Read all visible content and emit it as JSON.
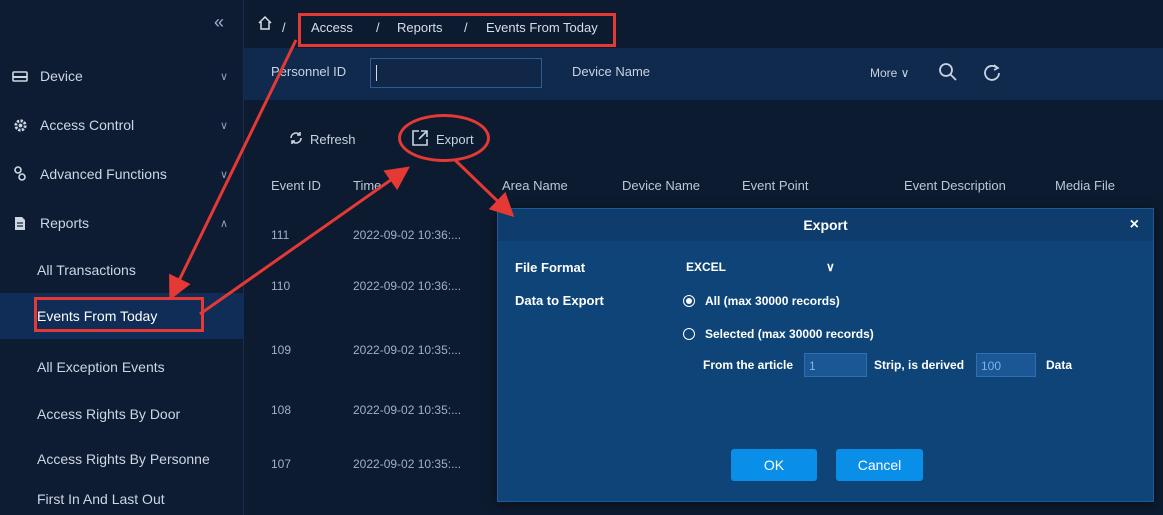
{
  "sidebar": {
    "collapse_glyph": "«",
    "sections": [
      {
        "label": "Device",
        "icon": "device-icon"
      },
      {
        "label": "Access Control",
        "icon": "gear-icon"
      },
      {
        "label": "Advanced Functions",
        "icon": "advanced-icon"
      },
      {
        "label": "Reports",
        "icon": "document-icon"
      }
    ],
    "report_items": [
      "All Transactions",
      "Events From Today",
      "All Exception Events",
      "Access Rights By Door",
      "Access Rights By Personne",
      "First In And Last Out"
    ],
    "active_item": "Events From Today"
  },
  "breadcrumb": {
    "home_icon": "home-icon",
    "separator": "/",
    "items": [
      "Access",
      "Reports",
      "Events From Today"
    ]
  },
  "filter": {
    "personnel_id_label": "Personnel ID",
    "personnel_id_value": "",
    "device_name_label": "Device Name",
    "more_label": "More"
  },
  "toolbar": {
    "refresh_label": "Refresh",
    "export_label": "Export"
  },
  "table": {
    "headers": [
      "Event ID",
      "Time",
      "Area Name",
      "Device Name",
      "Event Point",
      "Event Description",
      "Media File"
    ],
    "rows": [
      {
        "id": "111",
        "time": "2022-09-02 10:36:..."
      },
      {
        "id": "110",
        "time": "2022-09-02 10:36:..."
      },
      {
        "id": "109",
        "time": "2022-09-02 10:35:..."
      },
      {
        "id": "108",
        "time": "2022-09-02 10:35:..."
      },
      {
        "id": "107",
        "time": "2022-09-02 10:35:..."
      }
    ]
  },
  "dialog": {
    "title": "Export",
    "close_glyph": "×",
    "file_format_label": "File Format",
    "file_format_value": "EXCEL",
    "data_to_export_label": "Data to Export",
    "option_all": "All (max 30000 records)",
    "option_selected": "Selected (max 30000 records)",
    "selected_option": "all",
    "from_article_label": "From the article",
    "from_value": "1",
    "strip_derived_label": "Strip, is derived",
    "derived_value": "100",
    "data_suffix": "Data",
    "ok_label": "OK",
    "cancel_label": "Cancel"
  },
  "colors": {
    "annotation_red": "#e53935",
    "accent_blue": "#0a8fe8",
    "dialog_bg": "#0e4478"
  }
}
